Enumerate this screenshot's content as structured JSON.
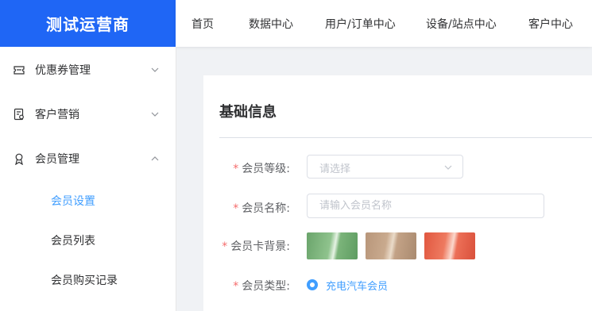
{
  "brand": {
    "name": "测试运营商",
    "color": "#1f66f5"
  },
  "topnav": {
    "items": [
      "首页",
      "数据中心",
      "用户/订单中心",
      "设备/站点中心",
      "客户中心"
    ]
  },
  "sidebar": {
    "menus": [
      {
        "label": "优惠券管理",
        "icon": "coupon-icon",
        "expanded": false
      },
      {
        "label": "客户营销",
        "icon": "marketing-icon",
        "expanded": false
      },
      {
        "label": "会员管理",
        "icon": "member-icon",
        "expanded": true
      }
    ],
    "submenu": [
      {
        "label": "会员设置",
        "active": true
      },
      {
        "label": "会员列表",
        "active": false
      },
      {
        "label": "会员购买记录",
        "active": false
      }
    ]
  },
  "form": {
    "title": "基础信息",
    "required_mark": "*",
    "level": {
      "label": "会员等级:",
      "placeholder": "请选择"
    },
    "name": {
      "label": "会员名称:",
      "placeholder": "请输入会员名称"
    },
    "background": {
      "label": "会员卡背景:",
      "options": [
        "green-card",
        "gold-card",
        "red-card"
      ]
    },
    "type": {
      "label": "会员类型:",
      "option": "充电汽车会员",
      "selected": true
    }
  },
  "colors": {
    "accent": "#409eff",
    "required": "#f56c6c"
  }
}
